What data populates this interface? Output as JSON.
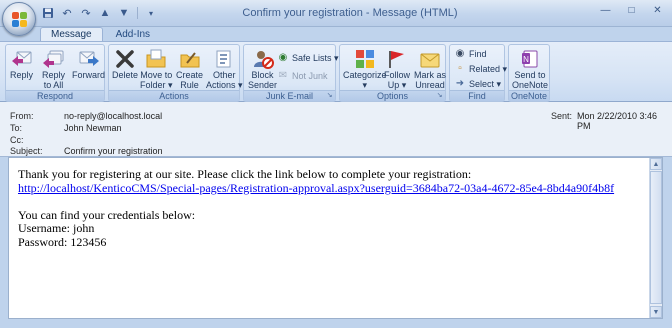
{
  "window": {
    "title": "Confirm your registration - Message (HTML)"
  },
  "quick_access": {
    "icons": [
      "save-icon",
      "undo-icon",
      "redo-icon",
      "up-arrow-icon",
      "down-arrow-icon",
      "customize-icon"
    ]
  },
  "tabs": [
    {
      "label": "Message",
      "active": true
    },
    {
      "label": "Add-Ins",
      "active": false
    }
  ],
  "ribbon": {
    "groups": {
      "respond": {
        "label": "Respond",
        "reply": "Reply",
        "reply_all_line1": "Reply",
        "reply_all_line2": "to All",
        "forward": "Forward"
      },
      "actions": {
        "label": "Actions",
        "delete": "Delete",
        "move_line1": "Move to",
        "move_line2": "Folder ▾",
        "create_line1": "Create",
        "create_line2": "Rule",
        "other_line1": "Other",
        "other_line2": "Actions ▾"
      },
      "junk": {
        "label": "Junk E-mail",
        "block_line1": "Block",
        "block_line2": "Sender",
        "safe_lists": "Safe Lists ▾",
        "not_junk": "Not Junk"
      },
      "options": {
        "label": "Options",
        "categorize": "Categorize",
        "follow_line1": "Follow",
        "follow_line2": "Up ▾",
        "mark_line1": "Mark as",
        "mark_line2": "Unread"
      },
      "find": {
        "label": "Find",
        "find": "Find",
        "related": "Related ▾",
        "select": "Select ▾"
      },
      "onenote": {
        "label": "OneNote",
        "send_line1": "Send to",
        "send_line2": "OneNote"
      }
    }
  },
  "header": {
    "from_label": "From:",
    "from_value": "no-reply@localhost.local",
    "to_label": "To:",
    "to_value": "John Newman",
    "cc_label": "Cc:",
    "cc_value": "",
    "subject_label": "Subject:",
    "subject_value": "Confirm your registration",
    "sent_label": "Sent:",
    "sent_value": "Mon 2/22/2010 3:46 PM"
  },
  "message": {
    "line1": "Thank you for registering at our site. Please click the link below to complete your registration:",
    "link": "http://localhost/KenticoCMS/Special-pages/Registration-approval.aspx?userguid=3684ba72-03a4-4672-85e4-8bd4a90f4b8f",
    "line3": "You can find your credentials below:",
    "line4": "Username: john",
    "line5": "Password: 123456"
  },
  "colors": {
    "ribbon_bg": "#d7e4f5",
    "link": "#0000ee",
    "group_label": "#3c5f91"
  }
}
